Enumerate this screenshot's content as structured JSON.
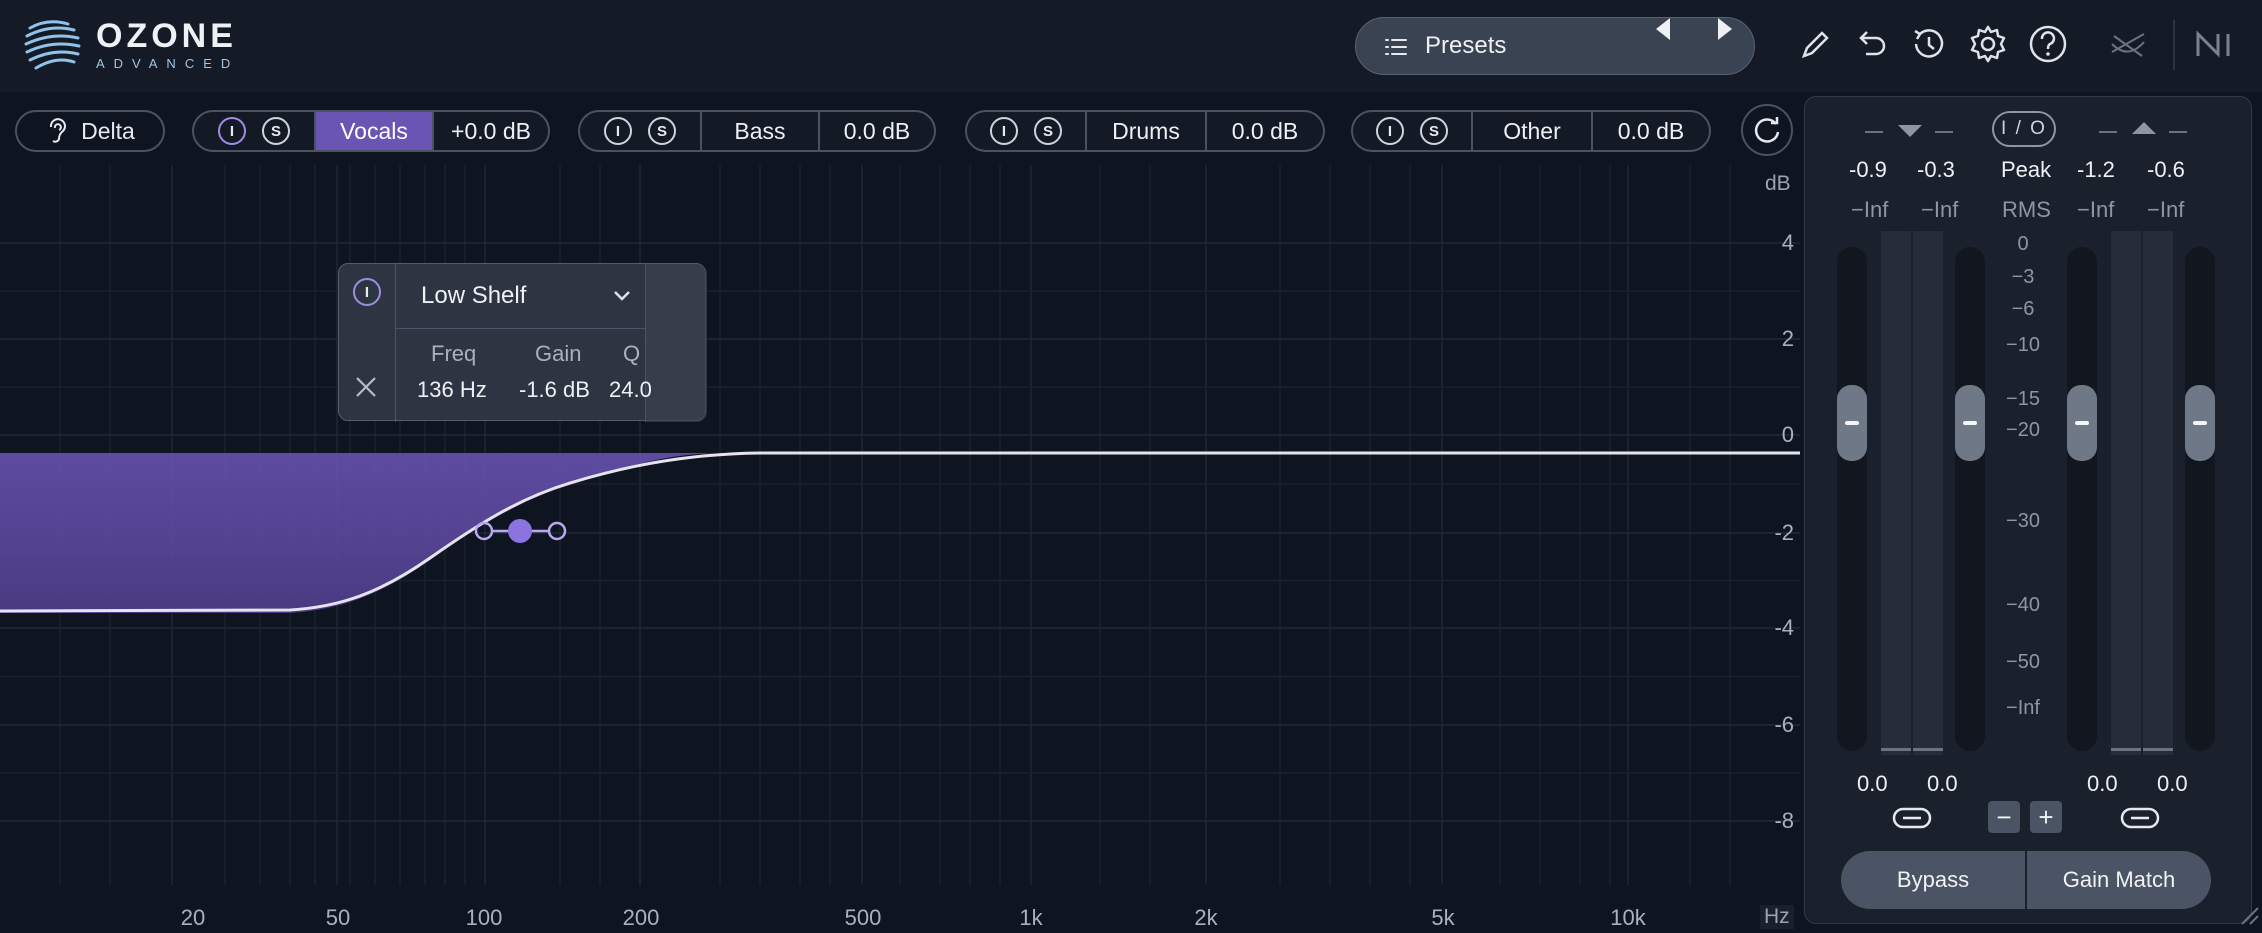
{
  "header": {
    "logo": {
      "name": "OZONE",
      "edition": "ADVANCED"
    },
    "presets_label": "Presets",
    "icons": [
      "pencil-icon",
      "undo-icon",
      "history-icon",
      "gear-icon",
      "help-icon",
      "routing-icon",
      "ni-logo-icon"
    ]
  },
  "bandbar": {
    "delta_label": "Delta",
    "bands": [
      {
        "name": "Vocals",
        "gain": "+0.0 dB",
        "active": true
      },
      {
        "name": "Bass",
        "gain": "0.0 dB",
        "active": false
      },
      {
        "name": "Drums",
        "gain": "0.0 dB",
        "active": false
      },
      {
        "name": "Other",
        "gain": "0.0 dB",
        "active": false
      }
    ],
    "power_glyph": "I",
    "solo_glyph": "S"
  },
  "eq": {
    "db_unit": "dB",
    "db_ticks": [
      "4",
      "2",
      "0",
      "-2",
      "-4",
      "-6",
      "-8"
    ],
    "freq_unit": "Hz",
    "freq_ticks": [
      "20",
      "50",
      "100",
      "200",
      "500",
      "1k",
      "2k",
      "5k",
      "10k"
    ],
    "accent_color": "#7b62c8"
  },
  "popup": {
    "filter_type": "Low Shelf",
    "freq_label": "Freq",
    "gain_label": "Gain",
    "q_label": "Q",
    "freq_value": "136 Hz",
    "gain_value": "-1.6 dB",
    "q_value": "24.0"
  },
  "meter": {
    "io_label": "I / O",
    "peak_in_l": "-0.9",
    "peak_in_r": "-0.3",
    "peak_label": "Peak",
    "peak_out_l": "-1.2",
    "peak_out_r": "-0.6",
    "rms_in_l": "−Inf",
    "rms_in_r": "−Inf",
    "rms_label": "RMS",
    "rms_out_l": "−Inf",
    "rms_out_r": "−Inf",
    "scale": [
      "0",
      "−3",
      "−6",
      "−10",
      "−15",
      "−20",
      "−30",
      "−40",
      "−50",
      "−Inf"
    ],
    "gain_in_l": "0.0",
    "gain_in_r": "0.0",
    "gain_out_l": "0.0",
    "gain_out_r": "0.0",
    "minus": "−",
    "plus": "+",
    "bypass_label": "Bypass",
    "gain_match_label": "Gain Match"
  }
}
